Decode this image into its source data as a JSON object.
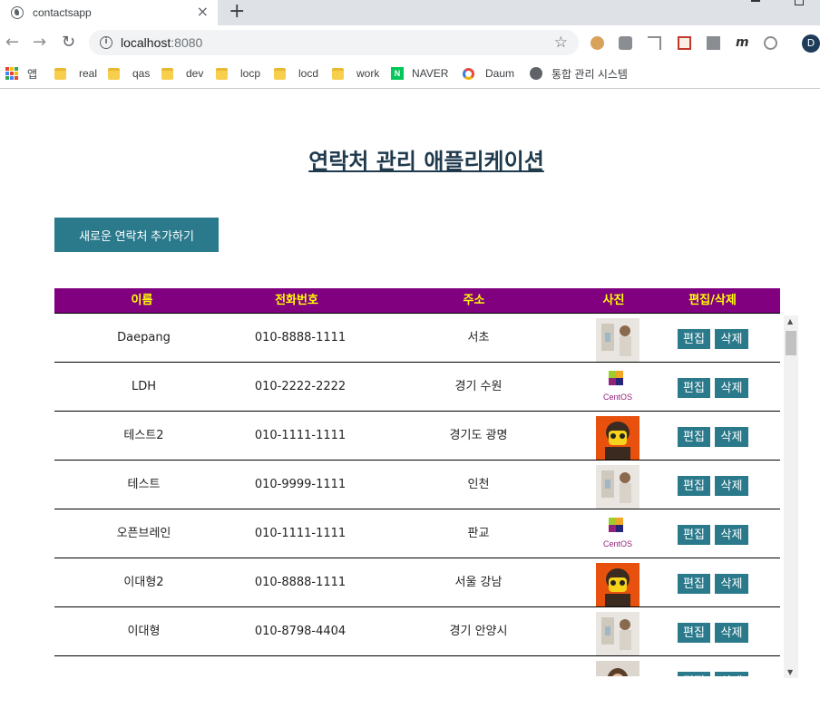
{
  "browser": {
    "tab_title": "contactsapp",
    "tab_close": "×",
    "new_tab": "+",
    "url_host": "localhost",
    "url_port": ":8080",
    "profile_initial": "D",
    "nav": {
      "back": "←",
      "forward": "→",
      "reload": "↻"
    },
    "star": "☆"
  },
  "bookmarks": [
    {
      "label": "앱",
      "icon": "apps-icon"
    },
    {
      "label": "real",
      "icon": "folder-icon"
    },
    {
      "label": "qas",
      "icon": "folder-icon"
    },
    {
      "label": "dev",
      "icon": "folder-icon"
    },
    {
      "label": "locp",
      "icon": "folder-icon"
    },
    {
      "label": "locd",
      "icon": "folder-icon"
    },
    {
      "label": "work",
      "icon": "folder-icon"
    },
    {
      "label": "NAVER",
      "icon": "naver-icon",
      "icon_text": "N"
    },
    {
      "label": "Daum",
      "icon": "daum-icon"
    },
    {
      "label": "통합 관리 시스템",
      "icon": "globe-icon"
    }
  ],
  "page": {
    "title": "연락처 관리 애플리케이션",
    "add_button": "새로운 연락처 추가하기"
  },
  "table": {
    "headers": [
      "이름",
      "전화번호",
      "주소",
      "사진",
      "편집/삭제"
    ],
    "edit_label": "편집",
    "delete_label": "삭제",
    "rows": [
      {
        "name": "Daepang",
        "phone": "010-8888-1111",
        "address": "서초",
        "photo": "photo-person"
      },
      {
        "name": "LDH",
        "phone": "010-2222-2222",
        "address": "경기 수원",
        "photo": "photo-centos-logo"
      },
      {
        "name": "테스트2",
        "phone": "010-1111-1111",
        "address": "경기도 광명",
        "photo": "photo-lego"
      },
      {
        "name": "테스트",
        "phone": "010-9999-1111",
        "address": "인천",
        "photo": "photo-person"
      },
      {
        "name": "오픈브레인",
        "phone": "010-1111-1111",
        "address": "판교",
        "photo": "photo-centos-logo"
      },
      {
        "name": "이대형2",
        "phone": "010-8888-1111",
        "address": "서울 강남",
        "photo": "photo-lego"
      },
      {
        "name": "이대형",
        "phone": "010-8798-4404",
        "address": "경기 안양시",
        "photo": "photo-person"
      },
      {
        "name": "",
        "phone": "",
        "address": "",
        "photo": "photo-woman"
      }
    ]
  },
  "colors": {
    "header_bg": "#800080",
    "header_text": "#ffff00",
    "button_bg": "#2a7a8c",
    "title": "#1f3a4d"
  }
}
